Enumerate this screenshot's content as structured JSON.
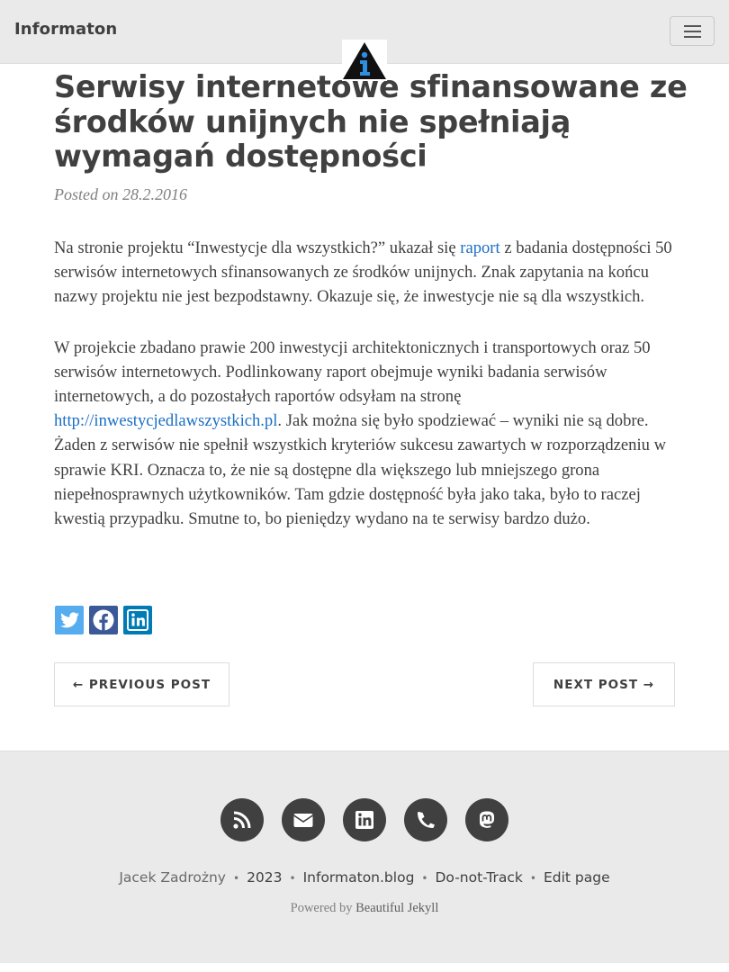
{
  "navbar": {
    "brand": "Informaton",
    "menu_icon": "hamburger-icon",
    "avatar_icon": "info-logo-icon"
  },
  "post": {
    "title": "Serwisy internetowe sfinansowane ze środków unijnych nie spełniają wymagań dostępności",
    "posted_on": "Posted on 28.2.2016",
    "p1": {
      "before": "Na stronie projektu “Inwestycje dla wszystkich?” ukazał się ",
      "link": "raport",
      "after": " z badania dostępności 50 serwisów internetowych sfinansowanych ze środków unijnych. Znak zapytania na końcu nazwy projektu nie jest bezpodstawny. Okazuje się, że inwestycje nie są dla wszystkich."
    },
    "p2": {
      "before": "W projekcie zbadano prawie 200 inwestycji architektonicznych i transportowych oraz 50 serwisów internetowych. Podlinkowany raport obejmuje wyniki badania serwisów internetowych, a do pozostałych raportów odsyłam na stronę ",
      "link": "http://inwestycjedlawszystkich.pl",
      "after": ". Jak można się było spodziewać – wyniki nie są dobre. Żaden z serwisów nie spełnił wszystkich kryteriów sukcesu zawartych w rozporządzeniu w sprawie KRI. Oznacza to, że nie są dostępne dla większego lub mniejszego grona niepełnosprawnych użytkowników. Tam gdzie dostępność była jako taka, było to raczej kwestią przypadku. Smutne to, bo pieniędzy wydano na te serwisy bardzo dużo."
    }
  },
  "share": [
    {
      "icon": "twitter-icon",
      "color": "#55acee"
    },
    {
      "icon": "facebook-icon",
      "color": "#3b5998"
    },
    {
      "icon": "linkedin-icon",
      "color": "#007bb5"
    }
  ],
  "pager": {
    "previous": "← PREVIOUS POST",
    "next": "NEXT POST →"
  },
  "footer": {
    "icons": [
      "rss-icon",
      "envelope-icon",
      "linkedin-icon",
      "phone-icon",
      "mastodon-icon"
    ],
    "author": "Jacek Zadrożny",
    "year": "2023",
    "site": "Informaton.blog",
    "dnt": "Do-not-Track",
    "edit": "Edit page",
    "powered_prefix": "Powered by ",
    "powered_link": "Beautiful Jekyll"
  }
}
